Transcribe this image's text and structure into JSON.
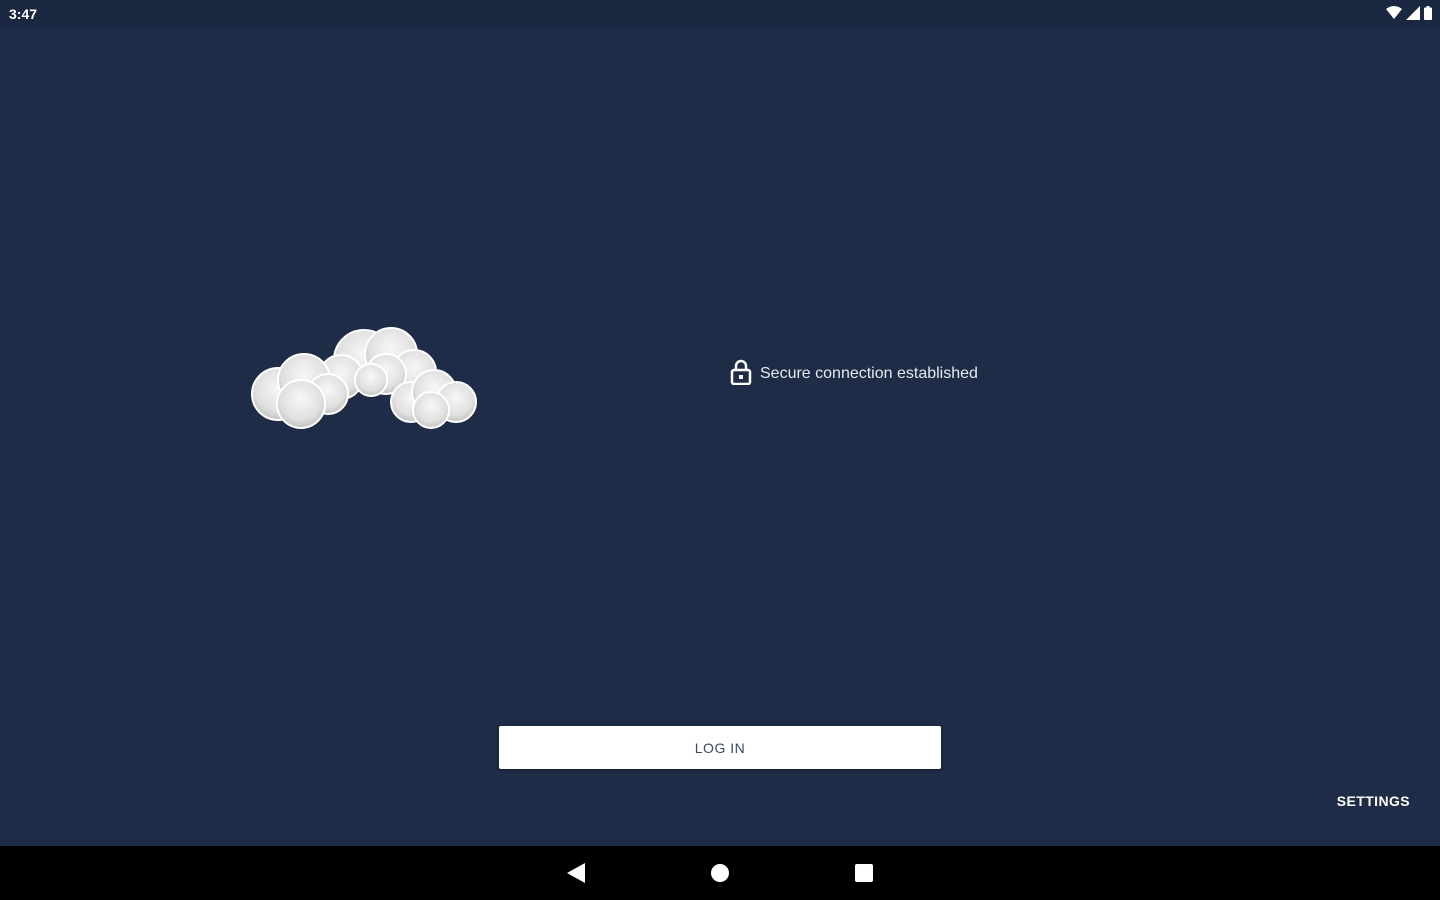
{
  "status_bar": {
    "time": "3:47",
    "icons": [
      "wifi-icon",
      "signal-icon",
      "battery-icon"
    ]
  },
  "logo": {
    "icon": "cloud-logo-icon"
  },
  "connection": {
    "icon": "lock-icon",
    "text": "Secure connection established"
  },
  "actions": {
    "login_label": "LOG IN",
    "settings_label": "SETTINGS"
  },
  "nav_bar": {
    "items": [
      "back-icon",
      "home-icon",
      "recents-icon"
    ]
  },
  "colors": {
    "background": "#1e2c47",
    "status_bar": "#1a2740",
    "nav_bar": "#000000",
    "button_bg": "#ffffff",
    "button_text": "#3a4a66"
  }
}
